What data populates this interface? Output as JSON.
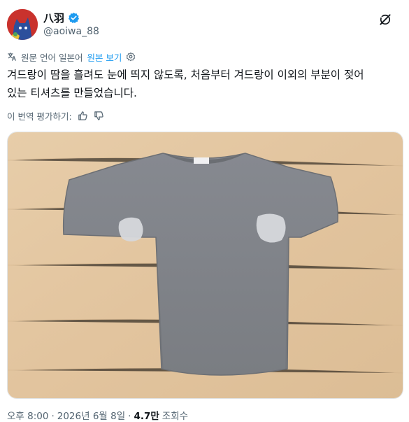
{
  "post": {
    "author": {
      "display_name": "八羽",
      "handle": "@aoiwa_88",
      "verified_icon": "verified-badge-icon",
      "verified_color": "#1d9bf0"
    },
    "translation": {
      "label": "원문 언어 일본어",
      "show_original": "원본 보기"
    },
    "text_lines": [
      "겨드랑이 땀을 흘려도 눈에 띄지 않도록, 처음부터 겨드랑이 이외의 부분이 젖어",
      "있는 티셔츠를 만들었습니다."
    ],
    "rate_translation": "이 번역 평가하기:",
    "media": {
      "description_icon": "photo"
    },
    "time": "오후 8:00",
    "separator": "·",
    "date": "2026년 6월 8일",
    "views_count": "4.7만",
    "views_label": "조회수"
  },
  "colors": {
    "accent": "#1d9bf0",
    "muted": "#536471",
    "text": "#0f1419",
    "shirt": "#7f8287",
    "background_wood": "#e4c9a6"
  }
}
